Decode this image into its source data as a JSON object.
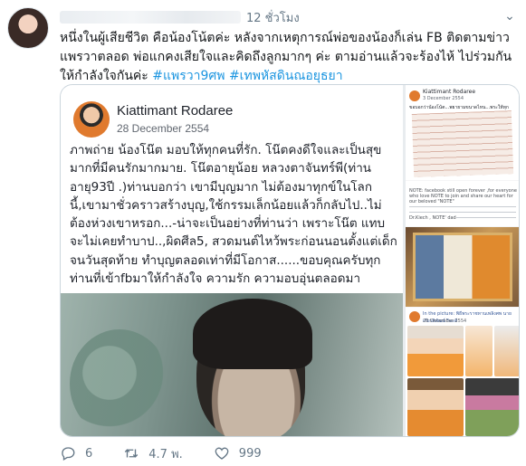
{
  "tweet": {
    "time": "12 ชั่วโมง",
    "text_main": "หนึ่งในผู้เสียชีวิต คือน้องโน้ตค่ะ หลังจากเหตุการณ์พ่อของน้องก็เล่น FB ติดตามข่าวแพรวาตลอด พ่อแกคงเสียใจและคิดถึงลูกมากๆ ค่ะ ตามอ่านแล้วจะร้องไห้ ไปร่วมกันให้กำลังใจกันค่ะ",
    "hashtag_1": "#แพรวา9ศพ",
    "hashtag_2": "#เทพหัสดินณอยุธยา"
  },
  "fb_post": {
    "author": "Kiattimant Rodaree",
    "date": "28 December 2554",
    "text": "ภาพถ่าย น้องโน๊ต มอบให้ทุกคนที่รัก. โน๊ตคงดีใจและเป็นสุขมากที่มีคนรักมากมาย. โน๊ตอายุน้อย หลวงตาจันทร์พี(ท่านอายุ93ปี .)ท่านบอกว่า เขามีบุญมาก ไม่ต้องมาทุกข์ในโลกนี้,เขามาชั่วคราวสร้างบุญ,ใช้กรรมเล็กน้อยแล้วก็กลับไป..ไม่ต้องห่วงเขาหรอก...-น่าจะเป็นอย่างที่ท่านว่า เพราะโน๊ต แทบจะไม่เคยทำบาป..,ผิดศีล5, สวดมนต์ไหว้พระก่อนนอนตั้งแต่เด็กจนวันสุดท้าย ทำบุญตลอดเท่าที่มีโอกาส......ขอบคุณครับทุกท่านที่เข้าfbมาให้กำลังใจ ความรัก ความอบอุ่นตลอดมา"
  },
  "collage": {
    "s1_name": "Kiattimant Rodaree",
    "s1_date": "3 December 2554",
    "s1_text": "ขอบอกว่าน้องโน้ต...พยายามขนาดไหน...พระให้ทุก",
    "s2_text_top": "NOTE: facebook still open forever ,for everyone who love NOTE to join and share our heart for our beloved \"NOTE\"",
    "s2_text_bottom": "Dr.Kiech , NOTE' dad",
    "s4_name": "In the picture: พิธีพระราชทานเพลิงศพ นาย เกียรติพัฒน์ ริดะดี",
    "s4_date": "28 December 2554"
  },
  "actions": {
    "replies": "6",
    "retweets": "4.7 พ.",
    "likes": "999"
  },
  "colors": {
    "link": "#1b95e0",
    "muted": "#657786",
    "text": "#14171a"
  }
}
